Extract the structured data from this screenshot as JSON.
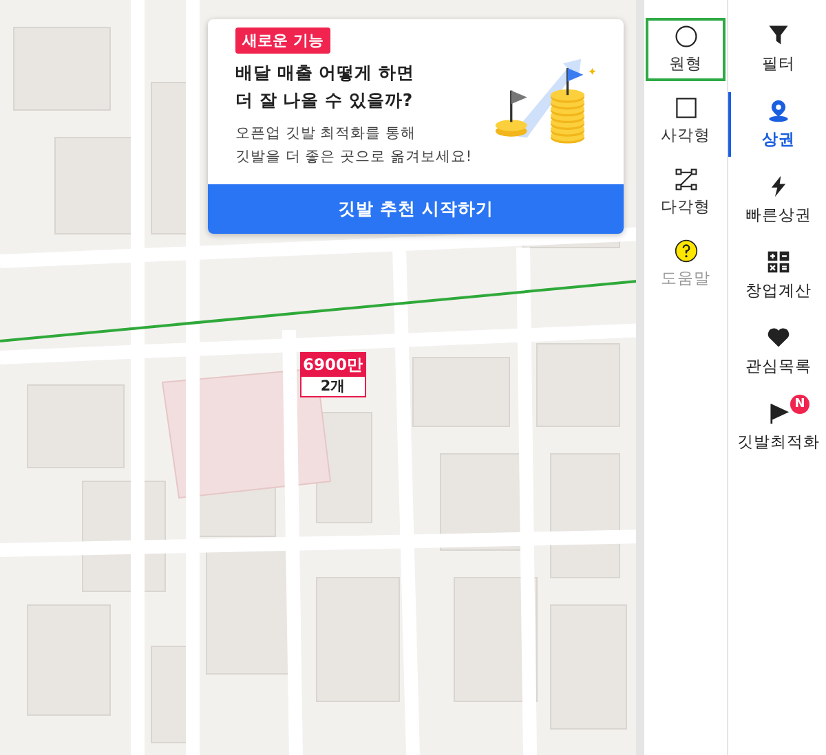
{
  "promo": {
    "tag": "새로운 기능",
    "headline": [
      "배달 매출 어떻게 하면",
      "더 잘 나올 수 있을까?"
    ],
    "body": [
      "오픈업 깃발 최적화를 통해",
      "깃발을 더 좋은 곳으로 옮겨보세요!"
    ],
    "button": "깃발 추천 시작하기"
  },
  "marker": {
    "price": "6900만",
    "count": "2개"
  },
  "tools": [
    {
      "kind": "circle",
      "label": "원형",
      "selected": true
    },
    {
      "kind": "square",
      "label": "사각형",
      "selected": false
    },
    {
      "kind": "polygon",
      "label": "다각형",
      "selected": false
    },
    {
      "kind": "help",
      "label": "도움말",
      "selected": false
    }
  ],
  "nav": [
    {
      "kind": "filter",
      "label": "필터",
      "selected": false
    },
    {
      "kind": "pin",
      "label": "상권",
      "selected": true
    },
    {
      "kind": "bolt",
      "label": "빠른상권",
      "selected": false
    },
    {
      "kind": "calc",
      "label": "창업계산",
      "selected": false
    },
    {
      "kind": "heart",
      "label": "관심목록",
      "selected": false
    },
    {
      "kind": "flag",
      "label": "깃발최적화",
      "selected": false,
      "badge": "N"
    }
  ]
}
